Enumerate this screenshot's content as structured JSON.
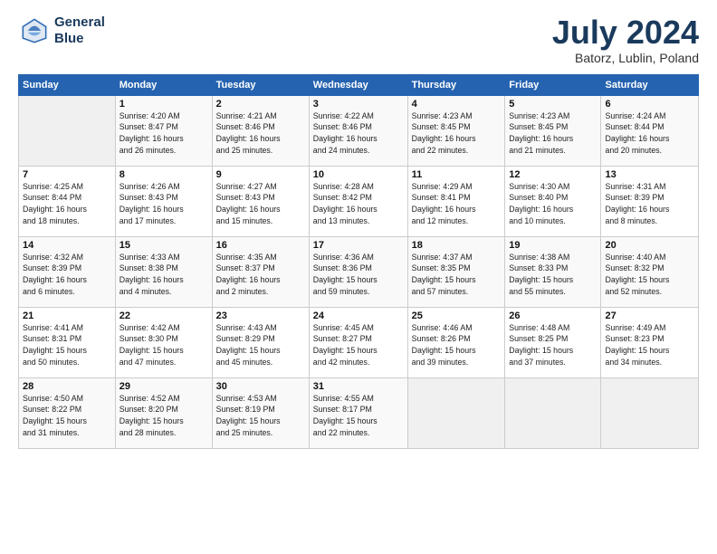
{
  "logo": {
    "line1": "General",
    "line2": "Blue"
  },
  "title": "July 2024",
  "subtitle": "Batorz, Lublin, Poland",
  "days_header": [
    "Sunday",
    "Monday",
    "Tuesday",
    "Wednesday",
    "Thursday",
    "Friday",
    "Saturday"
  ],
  "weeks": [
    [
      {
        "num": "",
        "info": ""
      },
      {
        "num": "1",
        "info": "Sunrise: 4:20 AM\nSunset: 8:47 PM\nDaylight: 16 hours\nand 26 minutes."
      },
      {
        "num": "2",
        "info": "Sunrise: 4:21 AM\nSunset: 8:46 PM\nDaylight: 16 hours\nand 25 minutes."
      },
      {
        "num": "3",
        "info": "Sunrise: 4:22 AM\nSunset: 8:46 PM\nDaylight: 16 hours\nand 24 minutes."
      },
      {
        "num": "4",
        "info": "Sunrise: 4:23 AM\nSunset: 8:45 PM\nDaylight: 16 hours\nand 22 minutes."
      },
      {
        "num": "5",
        "info": "Sunrise: 4:23 AM\nSunset: 8:45 PM\nDaylight: 16 hours\nand 21 minutes."
      },
      {
        "num": "6",
        "info": "Sunrise: 4:24 AM\nSunset: 8:44 PM\nDaylight: 16 hours\nand 20 minutes."
      }
    ],
    [
      {
        "num": "7",
        "info": "Sunrise: 4:25 AM\nSunset: 8:44 PM\nDaylight: 16 hours\nand 18 minutes."
      },
      {
        "num": "8",
        "info": "Sunrise: 4:26 AM\nSunset: 8:43 PM\nDaylight: 16 hours\nand 17 minutes."
      },
      {
        "num": "9",
        "info": "Sunrise: 4:27 AM\nSunset: 8:43 PM\nDaylight: 16 hours\nand 15 minutes."
      },
      {
        "num": "10",
        "info": "Sunrise: 4:28 AM\nSunset: 8:42 PM\nDaylight: 16 hours\nand 13 minutes."
      },
      {
        "num": "11",
        "info": "Sunrise: 4:29 AM\nSunset: 8:41 PM\nDaylight: 16 hours\nand 12 minutes."
      },
      {
        "num": "12",
        "info": "Sunrise: 4:30 AM\nSunset: 8:40 PM\nDaylight: 16 hours\nand 10 minutes."
      },
      {
        "num": "13",
        "info": "Sunrise: 4:31 AM\nSunset: 8:39 PM\nDaylight: 16 hours\nand 8 minutes."
      }
    ],
    [
      {
        "num": "14",
        "info": "Sunrise: 4:32 AM\nSunset: 8:39 PM\nDaylight: 16 hours\nand 6 minutes."
      },
      {
        "num": "15",
        "info": "Sunrise: 4:33 AM\nSunset: 8:38 PM\nDaylight: 16 hours\nand 4 minutes."
      },
      {
        "num": "16",
        "info": "Sunrise: 4:35 AM\nSunset: 8:37 PM\nDaylight: 16 hours\nand 2 minutes."
      },
      {
        "num": "17",
        "info": "Sunrise: 4:36 AM\nSunset: 8:36 PM\nDaylight: 15 hours\nand 59 minutes."
      },
      {
        "num": "18",
        "info": "Sunrise: 4:37 AM\nSunset: 8:35 PM\nDaylight: 15 hours\nand 57 minutes."
      },
      {
        "num": "19",
        "info": "Sunrise: 4:38 AM\nSunset: 8:33 PM\nDaylight: 15 hours\nand 55 minutes."
      },
      {
        "num": "20",
        "info": "Sunrise: 4:40 AM\nSunset: 8:32 PM\nDaylight: 15 hours\nand 52 minutes."
      }
    ],
    [
      {
        "num": "21",
        "info": "Sunrise: 4:41 AM\nSunset: 8:31 PM\nDaylight: 15 hours\nand 50 minutes."
      },
      {
        "num": "22",
        "info": "Sunrise: 4:42 AM\nSunset: 8:30 PM\nDaylight: 15 hours\nand 47 minutes."
      },
      {
        "num": "23",
        "info": "Sunrise: 4:43 AM\nSunset: 8:29 PM\nDaylight: 15 hours\nand 45 minutes."
      },
      {
        "num": "24",
        "info": "Sunrise: 4:45 AM\nSunset: 8:27 PM\nDaylight: 15 hours\nand 42 minutes."
      },
      {
        "num": "25",
        "info": "Sunrise: 4:46 AM\nSunset: 8:26 PM\nDaylight: 15 hours\nand 39 minutes."
      },
      {
        "num": "26",
        "info": "Sunrise: 4:48 AM\nSunset: 8:25 PM\nDaylight: 15 hours\nand 37 minutes."
      },
      {
        "num": "27",
        "info": "Sunrise: 4:49 AM\nSunset: 8:23 PM\nDaylight: 15 hours\nand 34 minutes."
      }
    ],
    [
      {
        "num": "28",
        "info": "Sunrise: 4:50 AM\nSunset: 8:22 PM\nDaylight: 15 hours\nand 31 minutes."
      },
      {
        "num": "29",
        "info": "Sunrise: 4:52 AM\nSunset: 8:20 PM\nDaylight: 15 hours\nand 28 minutes."
      },
      {
        "num": "30",
        "info": "Sunrise: 4:53 AM\nSunset: 8:19 PM\nDaylight: 15 hours\nand 25 minutes."
      },
      {
        "num": "31",
        "info": "Sunrise: 4:55 AM\nSunset: 8:17 PM\nDaylight: 15 hours\nand 22 minutes."
      },
      {
        "num": "",
        "info": ""
      },
      {
        "num": "",
        "info": ""
      },
      {
        "num": "",
        "info": ""
      }
    ]
  ]
}
